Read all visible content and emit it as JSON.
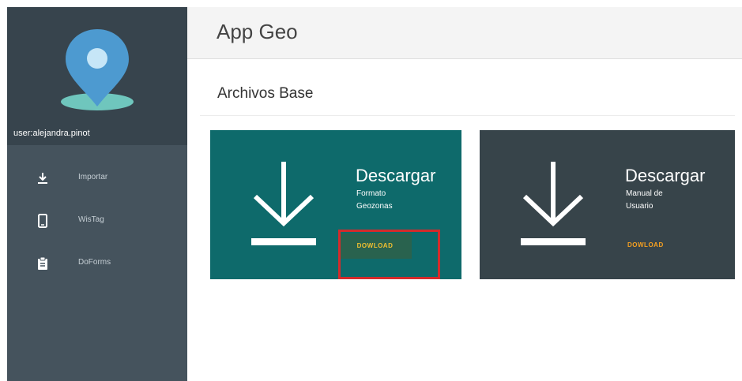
{
  "app": {
    "title": "App Geo"
  },
  "user": {
    "name": "user:alejandra.pinot"
  },
  "sidebar": {
    "items": [
      {
        "label": "Importar",
        "icon": "import-icon"
      },
      {
        "label": "WisTag",
        "icon": "phone-icon"
      },
      {
        "label": "DoForms",
        "icon": "clipboard-icon"
      }
    ]
  },
  "main": {
    "section_title": "Archivos Base",
    "cards": [
      {
        "title": "Descargar",
        "subtitle_1": "Formato",
        "subtitle_2": "Geozonas",
        "button": "DOWLOAD"
      },
      {
        "title": "Descargar",
        "subtitle_1": "Manual de",
        "subtitle_2": "Usuario",
        "button": "DOWLOAD"
      }
    ]
  },
  "colors": {
    "sidebar": "#45535d",
    "user_panel": "#37444d",
    "card_teal": "#0e6a6b",
    "card_dark": "#37444a",
    "button_text": "#f2c030",
    "highlight": "#d42b2b"
  }
}
